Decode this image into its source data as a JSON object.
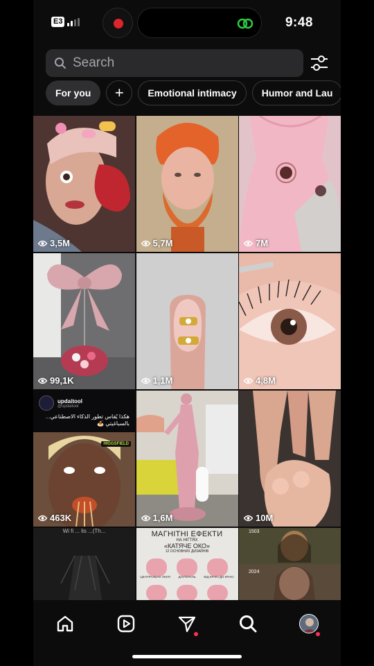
{
  "status": {
    "carrier_badge": "E3",
    "time": "9:48"
  },
  "search": {
    "placeholder": "Search"
  },
  "chips": [
    {
      "label": "For you",
      "active": true
    },
    {
      "label": "+"
    },
    {
      "label": "Emotional intimacy"
    },
    {
      "label": "Humor and Lau"
    }
  ],
  "grid": [
    {
      "views": "3,5M"
    },
    {
      "views": "5,7M"
    },
    {
      "views": "7M"
    },
    {
      "views": "99,1K"
    },
    {
      "views": "1,1M"
    },
    {
      "views": "4,8M"
    },
    {
      "views": "463K",
      "post_name": "updaitool",
      "post_handle": "@updaitool",
      "post_text": "هكذا يُقاس تطور الذكاء الاصطناعي... بالسباغيتي 🍝",
      "post_tag": "HIGGSFIELD"
    },
    {
      "views": "1,6M"
    },
    {
      "views": "10M"
    },
    {
      "caption": "Wi fi ... lis ...(Th..."
    },
    {
      "title": "МАГНІТНІ ЕФЕКТИ",
      "sub": "НА НІГТЯХ",
      "title2": "«КАТЯЧЕ ОКО»",
      "sub2": "12 ОСНОВНИХ ДИЗАЙНІВ",
      "labels": [
        "ЦЕНТРАЛЬНА ЛІНІЯ",
        "ДІАГОНАЛЬ",
        "ВІД КРАЮ ДО КРАЮ"
      ]
    },
    {
      "year_top": "1503",
      "year_bottom": "2024"
    }
  ],
  "nav": {
    "items": [
      "home",
      "reels",
      "messages",
      "search",
      "profile"
    ]
  },
  "colors": {
    "accent_dot": "#ff2e55",
    "record": "#e0242c",
    "threads_green": "#2ecc40"
  }
}
